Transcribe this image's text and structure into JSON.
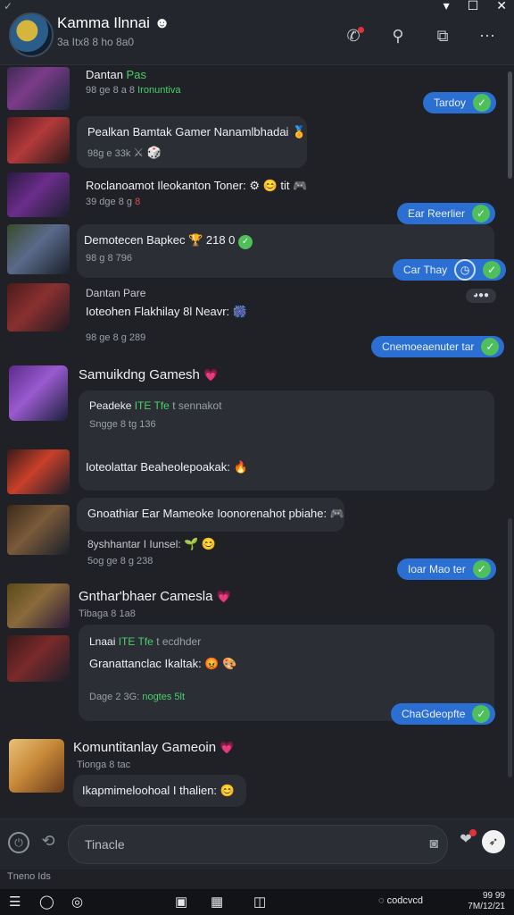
{
  "window": {
    "controls": [
      "▾",
      "☐",
      "✕"
    ]
  },
  "header": {
    "title": "Kamma Ilnnai ☻",
    "subtitle": "3a Itx8 8 ho 8a0",
    "icons": [
      "phone-icon",
      "search-icon",
      "camera-icon",
      "more-icon"
    ]
  },
  "messages": [
    {
      "name": "Dantan",
      "name_suffix": "Pas",
      "meta_prefix": "98 ge 8 a 8",
      "meta_green": "Ironuntiva",
      "chip": "Tardoy"
    },
    {
      "name": "Pealkan Bamtak Gamer Nanamlbhadai",
      "meta": "98g e 33k",
      "emoji": "⚔ 🎲"
    },
    {
      "name": "Roclanoamot Ileokanton Toner:",
      "meta_prefix": "39 dge 8 g",
      "meta_red": "8",
      "emoji": "⚙ 😊 tit 🎮",
      "chip": "Ear Reerlier"
    },
    {
      "name": "Demotecen Bapkec",
      "meta": "98 g 8 796",
      "emoji": "🏆 218 0",
      "chip": "Car Thay"
    },
    {
      "name": "Dantan Pare",
      "line2": "Ioteohen Flakhilay 8l Neavr:",
      "meta": "98 ge 8 g 289",
      "chip": "Cnemoeaenuter tar"
    },
    {
      "name": "Samuikdng Gamesh",
      "inner_label": "Peadeke",
      "inner_green": "ITE Tfe",
      "inner_rest": "t sennakot",
      "inner_meta": "Sngge 8 tg 136",
      "line2": "Ioteolattar Beaheolepoakak:"
    },
    {
      "name": "Gnoathiar Ear Mameoke Ioonorenahot pbiahe:",
      "line2": "8yshhantar I Iunsel:",
      "meta": "5og ge 8 g 238",
      "chip": "Ioar Mao ter"
    },
    {
      "name": "Gnthar'bhaer Camesla",
      "sub": "Tibaga 8 1a8",
      "inner_label": "Lnaai",
      "inner_green": "ITE Tfe",
      "inner_rest": "t ecdhder",
      "line2": "Granattanclac Ikaltak:",
      "meta_prefix": "Dage 2 3G:",
      "meta_green": "nogtes 5lt",
      "chip": "ChaGdeopfte"
    },
    {
      "name": "Komuntitanlay Gameoin",
      "sub": "Tionga 8 tac",
      "line2": "Ikapmimeloohoal I thalien:"
    }
  ],
  "composer": {
    "placeholder": "Tinacle",
    "value": ""
  },
  "status": "Tneno Ids",
  "taskbar": {
    "tray_text": "codcvcd",
    "time": "99 99",
    "date": "7M/12/21"
  }
}
